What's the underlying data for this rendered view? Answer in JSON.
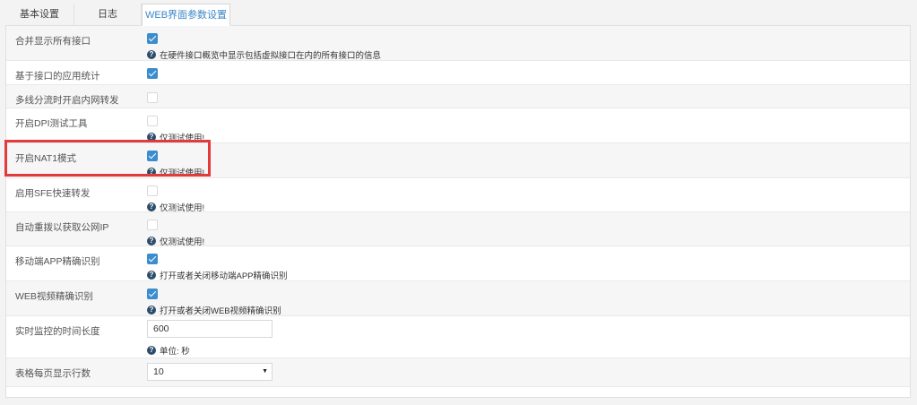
{
  "tabs": [
    "基本设置",
    "日志",
    "WEB界面参数设置"
  ],
  "active_tab": 2,
  "accent_color": "#3c8dce",
  "highlight_color": "#e23b3b",
  "settings": [
    {
      "label": "合并显示所有接口",
      "checked": true,
      "help": "在硬件接口概览中显示包括虚拟接口在内的所有接口的信息"
    },
    {
      "label": "基于接口的应用统计",
      "checked": true,
      "help": ""
    },
    {
      "label": "多线分流时开启内网转发",
      "checked": false,
      "help": ""
    },
    {
      "label": "开启DPI测试工具",
      "checked": false,
      "help": "仅测试使用!"
    },
    {
      "label": "开启NAT1模式",
      "checked": true,
      "help": "仅测试使用!"
    },
    {
      "label": "启用SFE快速转发",
      "checked": false,
      "help": "仅测试使用!"
    },
    {
      "label": "自动重拨以获取公网IP",
      "checked": false,
      "help": "仅测试使用!"
    },
    {
      "label": "移动端APP精确识别",
      "checked": true,
      "help": "打开或者关闭移动端APP精确识别"
    },
    {
      "label": "WEB视频精确识别",
      "checked": true,
      "help": "打开或者关闭WEB视频精确识别"
    }
  ],
  "monitor": {
    "label": "实时监控的时间长度",
    "value": "600",
    "help": "单位: 秒"
  },
  "rows_per_page": {
    "label": "表格每页显示行数",
    "selected": "10"
  },
  "help_icon": "question-circle-icon"
}
